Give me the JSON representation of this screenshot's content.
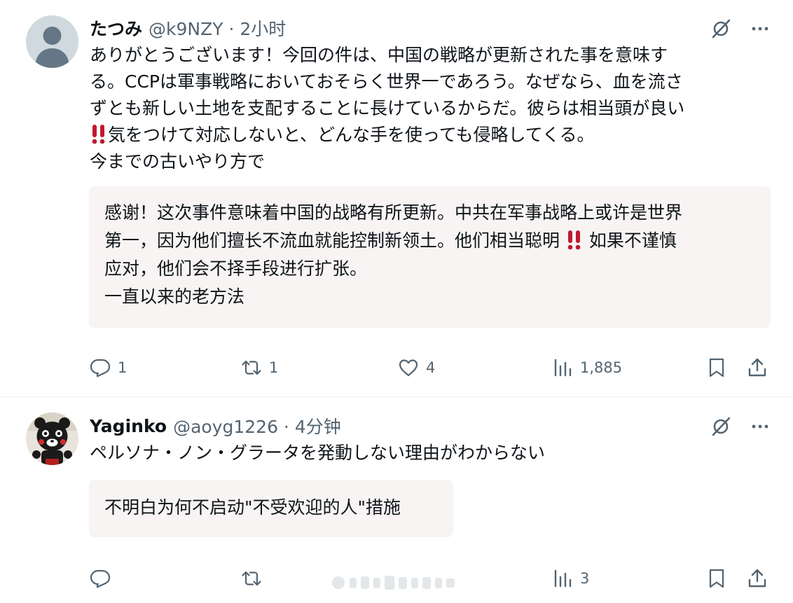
{
  "posts": [
    {
      "display_name": "たつみ",
      "handle_meta": "@k9NZY · 2小时",
      "text_lines": [
        "ありがとうございます！今回の件は、中国の戦略が更新された事を意味す",
        "る。CCPは軍事戦略においておそらく世界一であろう。なぜなら、血を流さ",
        "ずとも新しい土地を支配することに長けているからだ。彼らは相当頭が良い",
        "気をつけて対応しないと、どんな手を使っても侵略してくる。",
        "今までの古いやり方で"
      ],
      "translation_lines": [
        "感谢！这次事件意味着中国的战略有所更新。中共在军事战略上或许是世界",
        "第一，因为他们擅长不流血就能控制新领土。他们相当聪明",
        "如果不谨慎",
        "应对，他们会不择手段进行扩张。",
        "一直以来的老方法"
      ],
      "replies": "1",
      "reposts": "1",
      "likes": "4",
      "views": "1,885"
    },
    {
      "display_name": "Yaginko",
      "handle_meta": "@aoyg1226 · 4分钟",
      "text_lines": [
        "ペルソナ・ノン・グラータを発動しない理由がわからない"
      ],
      "translation_lines": [
        "不明白为何不启动\"不受欢迎的人\"措施"
      ],
      "replies": "",
      "reposts": "",
      "likes": "",
      "views": "3"
    }
  ],
  "icons": {
    "reply": "reply-icon",
    "repost": "repost-icon",
    "like": "like-icon",
    "views": "views-icon",
    "bookmark": "bookmark-icon",
    "share": "share-icon",
    "grok": "grok-icon",
    "more": "more-icon",
    "emphasis": "double-exclamation-icon"
  },
  "colors": {
    "text": "#0f1419",
    "secondary": "#536471",
    "translation_bg": "#f7f4f3",
    "exclamation": "#be1931"
  }
}
